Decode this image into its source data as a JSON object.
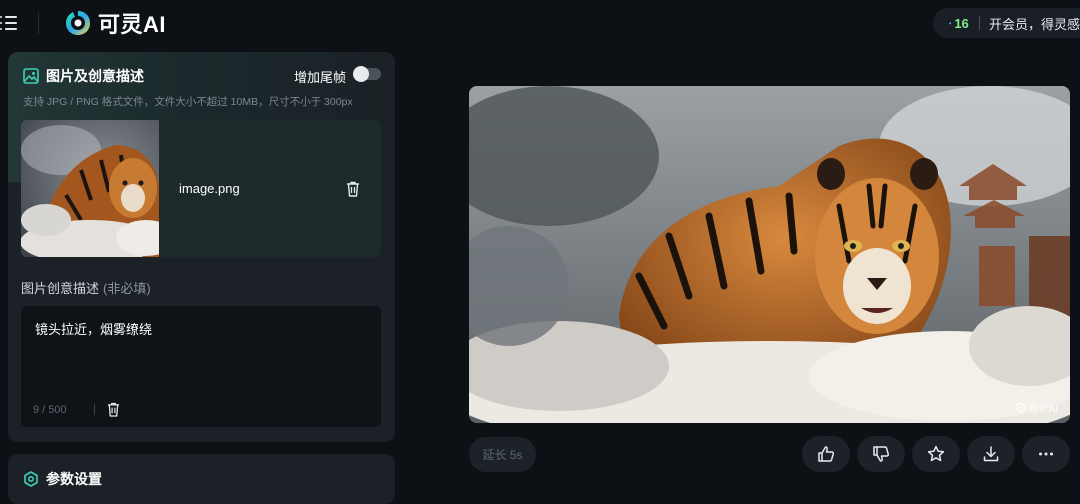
{
  "header": {
    "app_name": "可灵AI",
    "points": "16",
    "vip_text": "开会员，得灵感值"
  },
  "panel": {
    "title": "图片及创意描述",
    "tail_frame_label": "增加尾帧",
    "tail_frame_enabled": false,
    "upload_hint": "支持 JPG / PNG 格式文件，文件大小不超过 10MB，尺寸不小于 300px",
    "file_name": "image.png",
    "description_label": "图片创意描述",
    "description_optional": "(非必填)",
    "description_text": "镜头拉近，烟雾缭绕",
    "description_count": "9 / 500"
  },
  "panel2": {
    "title": "参数设置"
  },
  "preview": {
    "watermark": "可灵AI",
    "extend_label": "延长 5s"
  },
  "icons": {
    "menu": "menu-icon",
    "logo": "logo-icon",
    "flame": "flame-icon",
    "image": "image-icon",
    "trash": "trash-icon",
    "settings": "hexagon-settings-icon",
    "like": "thumbs-up-icon",
    "dislike": "thumbs-down-icon",
    "favorite": "star-icon",
    "download": "download-icon",
    "more": "more-icon"
  },
  "colors": {
    "accent_green": "#7cf08a",
    "teal": "#3fd1b8",
    "background": "#0d1014",
    "panel": "#1b2126"
  }
}
